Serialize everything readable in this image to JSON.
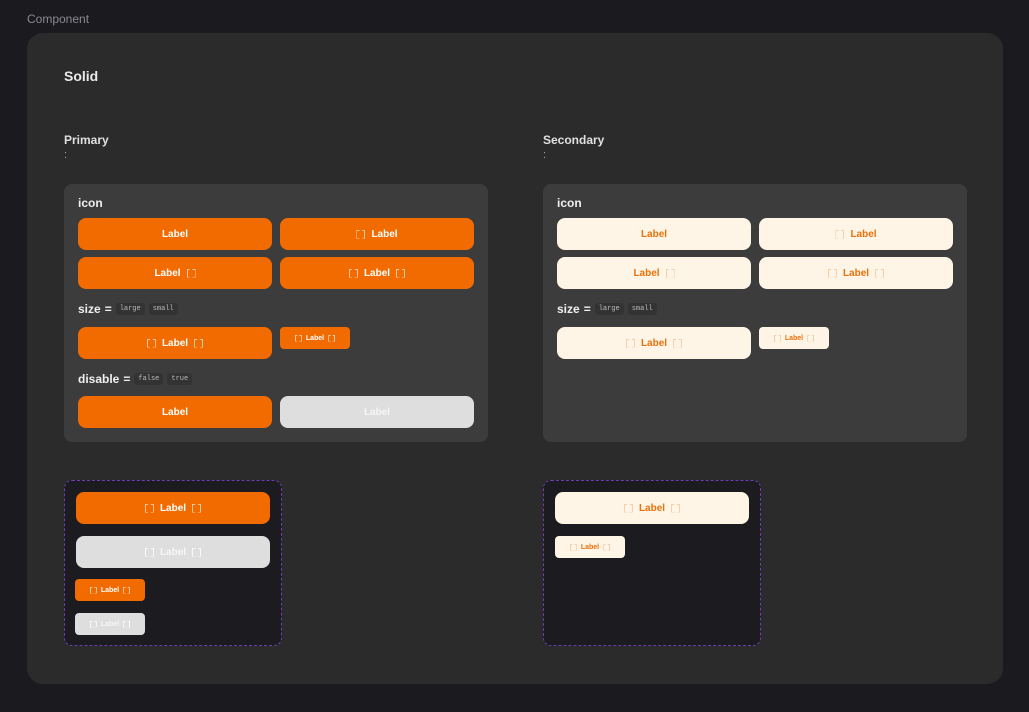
{
  "page_label": "Component",
  "section_title": "Solid",
  "primary": {
    "title": "Primary",
    "subtitle": ":",
    "icon_label": "icon",
    "size_label": "size",
    "size_eq": "=",
    "size_options": [
      "large",
      "small"
    ],
    "disable_label": "disable",
    "disable_eq": "=",
    "disable_options": [
      "false",
      "true"
    ],
    "button_label": "Label"
  },
  "secondary": {
    "title": "Secondary",
    "subtitle": ":",
    "icon_label": "icon",
    "size_label": "size",
    "size_eq": "=",
    "size_options": [
      "large",
      "small"
    ],
    "button_label": "Label"
  },
  "colors": {
    "primary": "#f26b00",
    "secondary_bg": "#fff5e6",
    "secondary_text": "#e8710a",
    "disabled": "#dedede",
    "frame_border": "#6a3fb0"
  }
}
